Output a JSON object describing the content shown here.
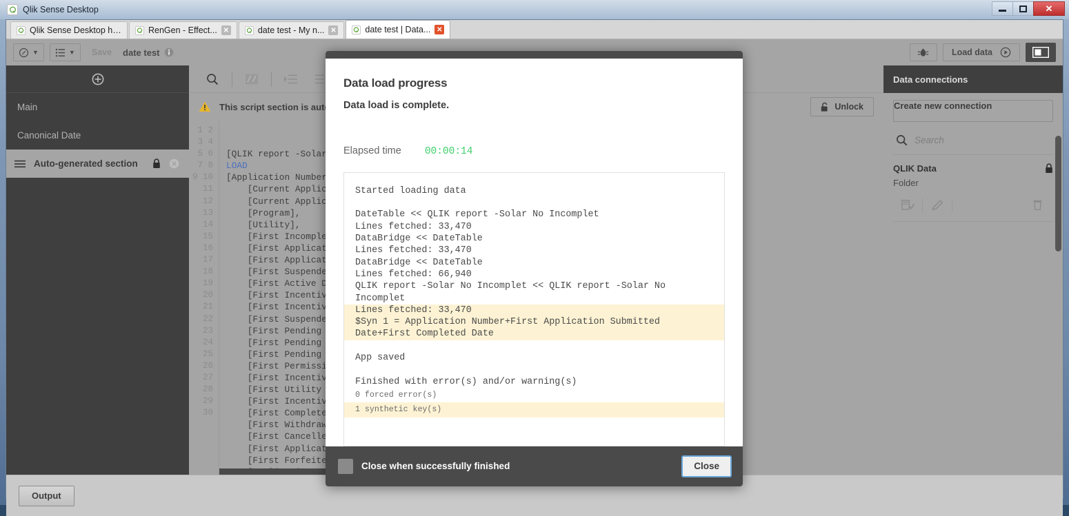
{
  "window": {
    "title": "Qlik Sense Desktop",
    "icon": "qlik-logo-icon",
    "minimize_label": "Minimize",
    "maximize_label": "Maximize",
    "close_label": "✕"
  },
  "browser_tabs": [
    {
      "label": "Qlik Sense Desktop hub",
      "closable": false,
      "active": false
    },
    {
      "label": "RenGen - Effect...",
      "closable": true,
      "active": false
    },
    {
      "label": "date test - My n...",
      "closable": true,
      "active": false
    },
    {
      "label": "date test | Data...",
      "closable": true,
      "active": true
    }
  ],
  "toolbar": {
    "nav_label": "",
    "sheets_label": "",
    "save_label": "Save",
    "app_name": "date test",
    "debug_label": "",
    "load_data_label": "Load data",
    "panel_toggle_label": ""
  },
  "sections": {
    "add_label": "+",
    "items": [
      {
        "label": "Main",
        "active": false,
        "locked": false
      },
      {
        "label": "Canonical Date",
        "active": false,
        "locked": false
      },
      {
        "label": "Auto-generated section",
        "active": true,
        "locked": true
      }
    ]
  },
  "editor": {
    "warning_text": "This script section is auto-g",
    "unlock_label": "Unlock",
    "line_numbers": [
      1,
      2,
      3,
      4,
      5,
      6,
      7,
      8,
      9,
      10,
      11,
      12,
      13,
      14,
      15,
      16,
      17,
      18,
      19,
      20,
      21,
      22,
      23,
      24,
      25,
      26,
      27,
      28,
      29,
      30
    ],
    "code_lines": [
      "",
      "",
      "[QLIK report -Solar",
      "LOAD",
      "[Application Number",
      "    [Current Applic",
      "    [Current Applic",
      "    [Program],",
      "    [Utility],",
      "    [First Incomple",
      "    [First Applicat",
      "    [First Applicat",
      "    [First Suspende",
      "    [First Active D",
      "    [First Incentiv",
      "    [First Incentiv",
      "    [First Suspende",
      "    [First Pending ",
      "    [First Pending ",
      "    [First Pending ",
      "    [First Permissi",
      "    [First Incentiv",
      "    [First Utility ",
      "    [First Incentiv",
      "    [First Complete",
      "    [First Withdraw",
      "    [First Cancelle",
      "    [First Applicat",
      "    [First Forfeite",
      "    [Application Fe"
    ],
    "keyword_line_index": 3
  },
  "right_panel": {
    "header": "Data connections",
    "create_label": "Create new connection",
    "search_placeholder": "Search",
    "connection": {
      "name": "QLIK Data",
      "type": "Folder",
      "locked": true
    }
  },
  "bottom": {
    "output_label": "Output"
  },
  "dialog": {
    "title": "Data load progress",
    "subtitle": "Data load is complete.",
    "elapsed_label": "Elapsed time",
    "elapsed_value": "00:00:14",
    "elapsed_color": "#3ecf6b",
    "log_lines": [
      {
        "text": "Started loading data",
        "highlight": false,
        "small": false
      },
      {
        "text": "",
        "highlight": false,
        "small": false
      },
      {
        "text": "DateTable << QLIK report -Solar No Incomplet",
        "highlight": false,
        "small": false
      },
      {
        "text": "Lines fetched: 33,470",
        "highlight": false,
        "small": false
      },
      {
        "text": "DataBridge << DateTable",
        "highlight": false,
        "small": false
      },
      {
        "text": "Lines fetched: 33,470",
        "highlight": false,
        "small": false
      },
      {
        "text": "DataBridge << DateTable",
        "highlight": false,
        "small": false
      },
      {
        "text": "Lines fetched: 66,940",
        "highlight": false,
        "small": false
      },
      {
        "text": "QLIK report -Solar No Incomplet << QLIK report -Solar No Incomplet",
        "highlight": false,
        "small": false
      },
      {
        "text": "Lines fetched: 33,470",
        "highlight": true,
        "small": false
      },
      {
        "text": "$Syn 1 = Application Number+First Application Submitted Date+First Completed Date",
        "highlight": true,
        "small": false
      },
      {
        "text": "",
        "highlight": false,
        "small": false
      },
      {
        "text": "App saved",
        "highlight": false,
        "small": false
      },
      {
        "text": "",
        "highlight": false,
        "small": false
      },
      {
        "text": "Finished with error(s) and/or warning(s)",
        "highlight": false,
        "small": false
      },
      {
        "text": "0 forced error(s)",
        "highlight": false,
        "small": true
      },
      {
        "text": "1 synthetic key(s)",
        "highlight": true,
        "small": true
      }
    ],
    "checkbox_label": "Close when successfully finished",
    "checkbox_checked": false,
    "close_label": "Close"
  }
}
